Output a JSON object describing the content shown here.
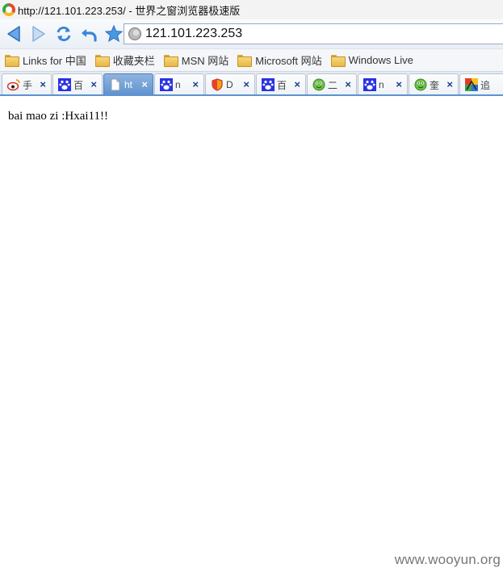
{
  "window": {
    "title": "http://121.101.223.253/ - 世界之窗浏览器极速版"
  },
  "address_bar": {
    "url": "121.101.223.253"
  },
  "bookmarks": [
    {
      "label": "Links for 中国"
    },
    {
      "label": "收藏夹栏"
    },
    {
      "label": "MSN 网站"
    },
    {
      "label": "Microsoft 网站"
    },
    {
      "label": "Windows Live"
    }
  ],
  "tabs": [
    {
      "label": "手",
      "icon": "weibo-icon",
      "active": false
    },
    {
      "label": "百",
      "icon": "baidu-paw-icon",
      "active": false
    },
    {
      "label": "ht",
      "icon": "blank-page-icon",
      "active": true
    },
    {
      "label": "n",
      "icon": "baidu-paw-icon",
      "active": false
    },
    {
      "label": "D",
      "icon": "shield-icon",
      "active": false
    },
    {
      "label": "百",
      "icon": "baidu-paw-icon",
      "active": false
    },
    {
      "label": "二",
      "icon": "green-frog-icon",
      "active": false
    },
    {
      "label": "n",
      "icon": "baidu-paw-icon",
      "active": false
    },
    {
      "label": "奎",
      "icon": "green-frog-icon",
      "active": false
    },
    {
      "label": "追",
      "icon": "puzzle-icon",
      "active": false
    }
  ],
  "tab_close_glyph": "×",
  "page": {
    "text": "bai mao zi :Hxai11!!"
  },
  "watermark": "www.wooyun.org",
  "colors": {
    "accent": "#5f92cf",
    "nav_blue": "#4a8fd6",
    "star": "#3a86d8"
  }
}
